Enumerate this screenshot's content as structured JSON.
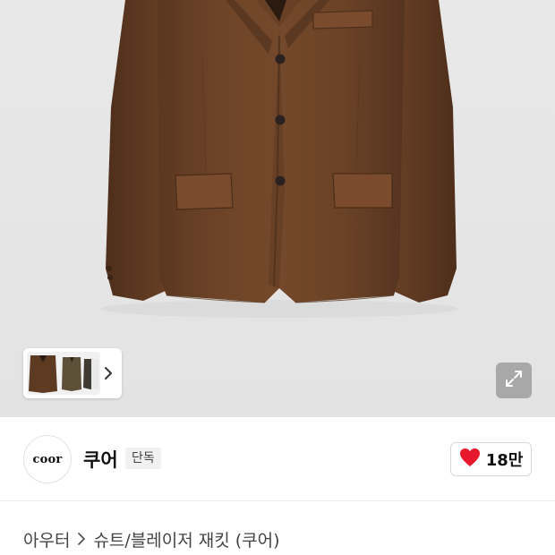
{
  "product_gallery": {
    "thumbnails_count_shown": 3,
    "icons": {
      "next": "chevron-right-icon",
      "expand": "expand-icon"
    }
  },
  "brand": {
    "logo_text": "coor",
    "name": "쿠어",
    "badge": "단독"
  },
  "like": {
    "count": "18만",
    "icon": "heart-icon",
    "icon_color": "#e8182c"
  },
  "breadcrumb": {
    "category": "아우터",
    "subcategory": "슈트/블레이저 재킷 (쿠어)",
    "separator_icon": "chevron-right-icon"
  },
  "colors": {
    "jacket_brown": "#6b4226",
    "background_gray": "#e6e6e6"
  }
}
